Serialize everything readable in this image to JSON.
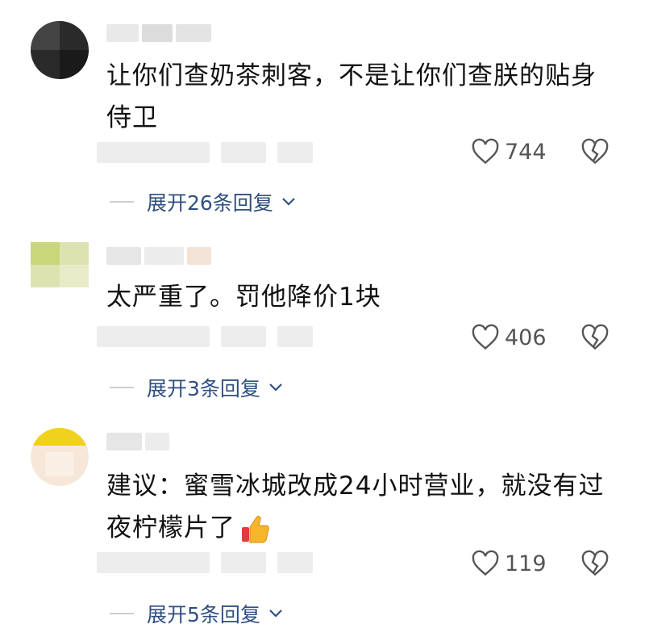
{
  "comments": [
    {
      "text": "让你们查奶茶刺客，不是让你们查朕的贴身侍卫",
      "likes": "744",
      "replies": "展开26条回复"
    },
    {
      "text": "太严重了。罚他降价1块",
      "likes": "406",
      "replies": "展开3条回复"
    },
    {
      "text": "建议：蜜雪冰城改成24小时营业，就没有过夜柠檬片了",
      "likes": "119",
      "replies": "展开5条回复"
    }
  ],
  "icons": {
    "like": "heart-outline-icon",
    "dislike": "broken-heart-icon",
    "expand": "chevron-down-icon",
    "emoji": "thumbs-up-emoji"
  },
  "colors": {
    "reply_link": "#2f4f7f",
    "icon_gray": "#555555"
  }
}
